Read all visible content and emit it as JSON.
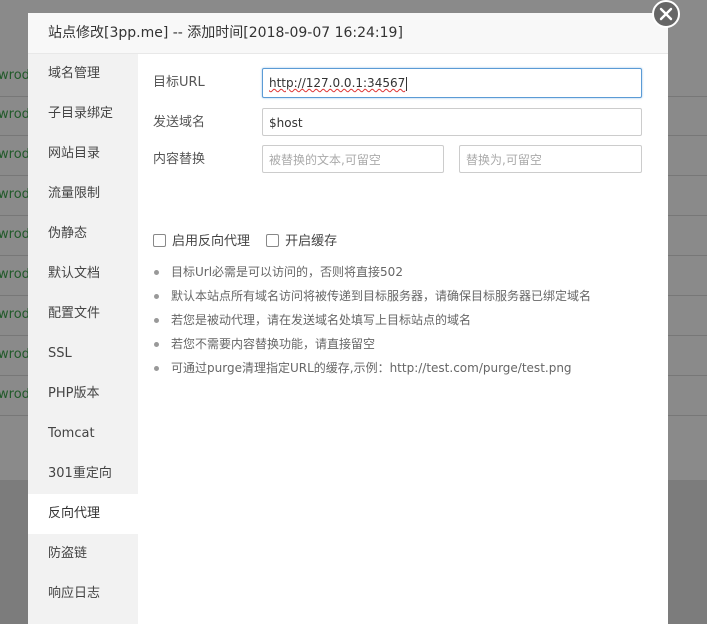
{
  "background": {
    "row_text": [
      "wrod",
      "wrod",
      "wrod",
      "wrod",
      "wrod",
      "wrod",
      "wrod",
      "wrod",
      "wrod"
    ]
  },
  "dialog": {
    "title": "站点修改[3pp.me] -- 添加时间[2018-09-07 16:24:19]"
  },
  "sidebar": {
    "items": [
      {
        "label": "域名管理"
      },
      {
        "label": "子目录绑定"
      },
      {
        "label": "网站目录"
      },
      {
        "label": "流量限制"
      },
      {
        "label": "伪静态"
      },
      {
        "label": "默认文档"
      },
      {
        "label": "配置文件"
      },
      {
        "label": "SSL"
      },
      {
        "label": "PHP版本"
      },
      {
        "label": "Tomcat"
      },
      {
        "label": "301重定向"
      },
      {
        "label": "反向代理"
      },
      {
        "label": "防盗链"
      },
      {
        "label": "响应日志"
      }
    ],
    "active": "反向代理"
  },
  "form": {
    "target_url_label": "目标URL",
    "target_url_value": "http://127.0.0.1:34567",
    "send_domain_label": "发送域名",
    "send_domain_value": "$host",
    "content_replace_label": "内容替换",
    "replace_from_placeholder": "被替换的文本,可留空",
    "replace_to_placeholder": "替换为,可留空",
    "enable_proxy_label": "启用反向代理",
    "enable_cache_label": "开启缓存"
  },
  "tips": [
    "目标Url必需是可以访问的，否则将直接502",
    "默认本站点所有域名访问将被传递到目标服务器，请确保目标服务器已绑定域名",
    "若您是被动代理，请在发送域名处填写上目标站点的域名",
    "若您不需要内容替换功能，请直接留空",
    "可通过purge清理指定URL的缓存,示例：http://test.com/purge/test.png"
  ],
  "colors": {
    "focus_border": "#5b9bd5",
    "sidebar_bg": "#f2f2f2",
    "overlay_bg": "#7f7f7f"
  }
}
